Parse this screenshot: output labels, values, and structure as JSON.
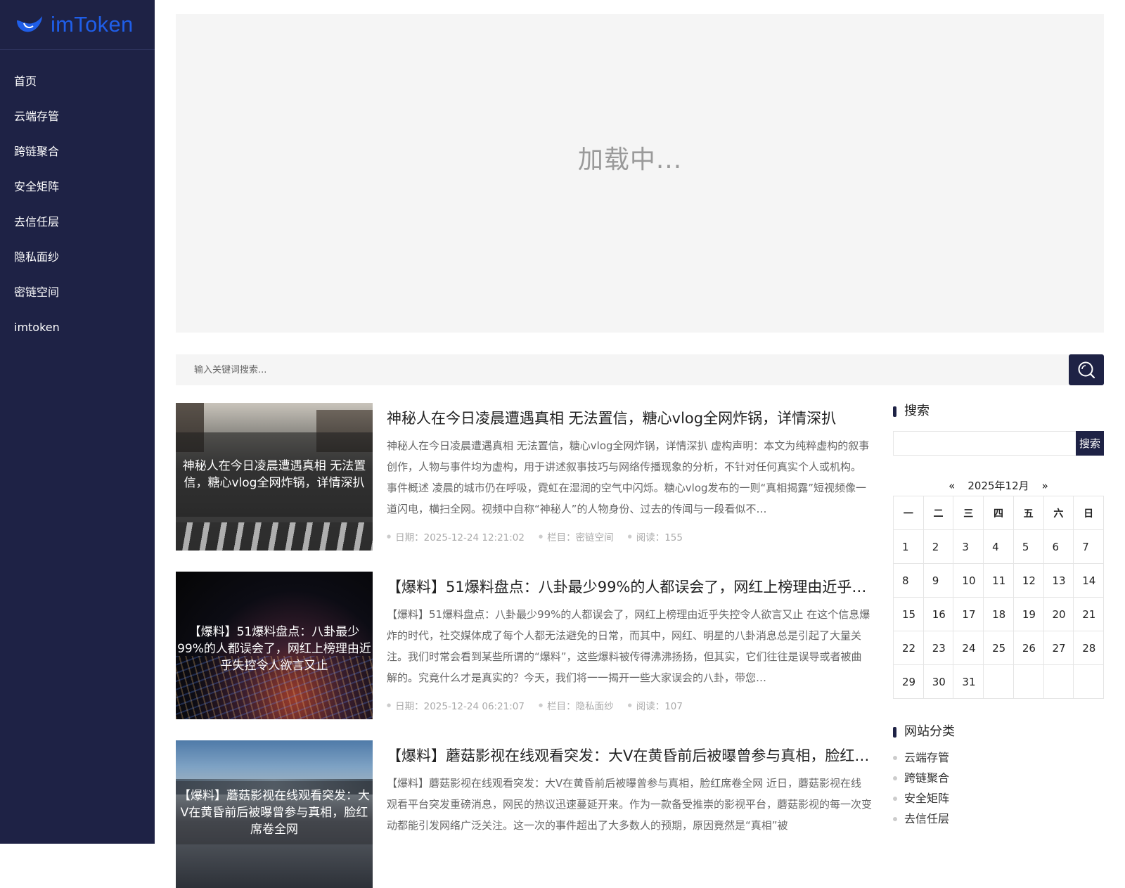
{
  "brand": {
    "name": "imToken"
  },
  "nav": [
    "首页",
    "云端存管",
    "跨链聚合",
    "安全矩阵",
    "去信任层",
    "隐私面纱",
    "密链空间",
    "imtoken"
  ],
  "banner": {
    "loading_text": "加载中..."
  },
  "search": {
    "placeholder": "输入关键词搜索..."
  },
  "articles": [
    {
      "title": "神秘人在今日凌晨遭遇真相 无法置信，糖心vlog全网炸锅，详情深扒",
      "thumb_text": "神秘人在今日凌晨遭遇真相 无法置信，糖心vlog全网炸锅，详情深扒",
      "excerpt": "神秘人在今日凌晨遭遇真相 无法置信，糖心vlog全网炸锅，详情深扒 虚构声明：本文为纯粹虚构的叙事创作，人物与事件均为虚构，用于讲述叙事技巧与网络传播现象的分析，不针对任何真实个人或机构。 事件概述 凌晨的城市仍在呼吸，霓虹在湿润的空气中闪烁。糖心vlog发布的一则“真相揭露”短视频像一道闪电，横扫全网。视频中自称“神秘人”的人物身份、过去的传闻与一段看似不…",
      "date": "日期：2025-12-24 12:21:02",
      "category": "栏目：密链空间",
      "reads": "阅读：155"
    },
    {
      "title": "【爆料】51爆料盘点：八卦最少99%的人都误会了，网红上榜理由近乎失控令人欲言又止",
      "thumb_text": "【爆料】51爆料盘点：八卦最少99%的人都误会了，网红上榜理由近乎失控令人欲言又止",
      "excerpt": "【爆料】51爆料盘点：八卦最少99%的人都误会了，网红上榜理由近乎失控令人欲言又止 在这个信息爆炸的时代，社交媒体成了每个人都无法避免的日常，而其中，网红、明星的八卦消息总是引起了大量关注。我们时常会看到某些所谓的“爆料”，这些爆料被传得沸沸扬扬，但其实，它们往往是误导或者被曲解的。究竟什么才是真实的？今天，我们将一一揭开一些大家误会的八卦，带您…",
      "date": "日期：2025-12-24 06:21:07",
      "category": "栏目：隐私面纱",
      "reads": "阅读：107"
    },
    {
      "title": "【爆料】蘑菇影视在线观看突发：大V在黄昏前后被曝曾参与真相，脸红席卷全网",
      "thumb_text": "【爆料】蘑菇影视在线观看突发：大V在黄昏前后被曝曾参与真相，脸红席卷全网",
      "excerpt": "【爆料】蘑菇影视在线观看突发：大V在黄昏前后被曝曾参与真相，脸红席卷全网 近日，蘑菇影视在线观看平台突发重磅消息，网民的热议迅速蔓延开来。作为一款备受推崇的影视平台，蘑菇影视的每一次变动都能引发网络广泛关注。这一次的事件超出了大多数人的预期，原因竟然是“真相”被"
    }
  ],
  "sidebar_widgets": {
    "search_title": "搜索",
    "search_button": "搜索",
    "calendar": {
      "prev": "«",
      "month": "2025年12月",
      "next": "»",
      "weekdays": [
        "一",
        "二",
        "三",
        "四",
        "五",
        "六",
        "日"
      ],
      "weeks": [
        [
          "1",
          "2",
          "3",
          "4",
          "5",
          "6",
          "7"
        ],
        [
          "8",
          "9",
          "10",
          "11",
          "12",
          "13",
          "14"
        ],
        [
          "15",
          "16",
          "17",
          "18",
          "19",
          "20",
          "21"
        ],
        [
          "22",
          "23",
          "24",
          "25",
          "26",
          "27",
          "28"
        ],
        [
          "29",
          "30",
          "31",
          "",
          "",
          "",
          ""
        ]
      ]
    },
    "category_title": "网站分类",
    "categories": [
      "云端存管",
      "跨链聚合",
      "安全矩阵",
      "去信任层"
    ]
  },
  "colors": {
    "sidebar": "#1e2245",
    "accent": "#1f5ee8"
  }
}
